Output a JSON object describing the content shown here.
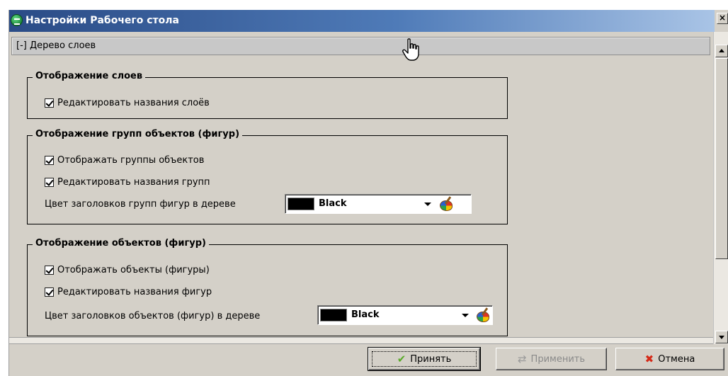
{
  "window": {
    "title": "Настройки Рабочего стола",
    "close_glyph": "×"
  },
  "section": {
    "header": "[-] Дерево слоев"
  },
  "layers_group": {
    "legend": "Отображение слоев",
    "edit_names": {
      "label": "Редактировать названия слоёв",
      "checked": true
    }
  },
  "groups_group": {
    "legend": "Отображение групп объектов (фигур)",
    "show_groups": {
      "label": "Отображать группы объектов",
      "checked": true
    },
    "edit_names": {
      "label": "Редактировать названия групп",
      "checked": true
    },
    "color_label": "Цвет заголовков групп фигур в дереве",
    "color_value": "Black",
    "color_hex": "#000000"
  },
  "objects_group": {
    "legend": "Отображение объектов (фигур)",
    "show_objects": {
      "label": "Отображать объекты (фигуры)",
      "checked": true
    },
    "edit_names": {
      "label": "Редактировать названия фигур",
      "checked": true
    },
    "color_label": "Цвет заголовков объектов (фигур) в дереве",
    "color_value": "Black",
    "color_hex": "#000000"
  },
  "buttons": {
    "accept": "Принять",
    "apply": "Применить",
    "cancel": "Отмена"
  },
  "icons": {
    "app": "desktop-app-icon",
    "palette": "palette-icon",
    "accept": "checkmark-icon",
    "apply": "refresh-icon",
    "cancel": "cross-icon",
    "cursor": "hand-pointer-icon"
  },
  "colors": {
    "titlebar_start": "#2a4b86",
    "titlebar_end": "#a9c4e6",
    "dialog_bg": "#d4d0c8",
    "cancel_icon": "#d42a18",
    "accept_icon": "#5aaa2a"
  }
}
